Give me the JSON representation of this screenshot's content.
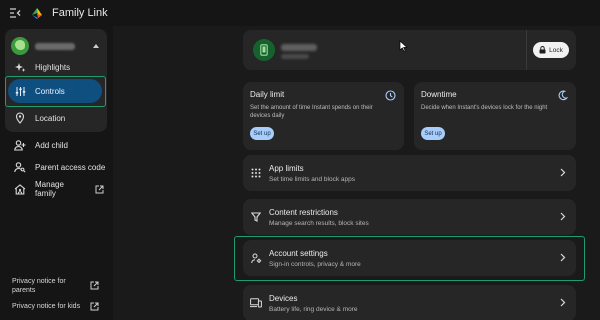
{
  "app": {
    "title": "Family Link"
  },
  "icons": {
    "menu": "menu-collapse-icon",
    "logo": "family-link-logo",
    "highlights": "sparkle-icon",
    "controls": "sliders-icon",
    "location": "location-pin-icon",
    "add_child": "add-person-icon",
    "parent_code": "person-key-icon",
    "manage_family": "family-house-icon",
    "external": "external-link-icon",
    "lock": "lock-icon",
    "daily_limit": "clock-icon",
    "downtime": "moon-icon",
    "app_limits": "apps-grid-icon",
    "content": "filter-icon",
    "account": "account-settings-icon",
    "devices": "devices-icon",
    "chevron": "chevron-right-icon"
  },
  "colors": {
    "accent_blue": "#0f4f7f",
    "button_blue": "#a9cdfa",
    "highlight_outline": "#1f9d6e",
    "avatar_green": "#3b9a3e"
  },
  "sidebar": {
    "nav": [
      {
        "label": "Highlights"
      },
      {
        "label": "Controls",
        "selected": true
      },
      {
        "label": "Location"
      }
    ],
    "actions": [
      {
        "label": "Add child"
      },
      {
        "label": "Parent access code"
      },
      {
        "label": "Manage family"
      }
    ],
    "footer": {
      "privacy_parents": "Privacy notice for parents",
      "privacy_kids": "Privacy notice for kids"
    }
  },
  "device_card": {
    "lock_label": "Lock"
  },
  "tiles": {
    "daily_limit": {
      "title": "Daily limit",
      "description": "Set the amount of time Instant spends on their devices daily",
      "button": "Set up"
    },
    "downtime": {
      "title": "Downtime",
      "description": "Decide when Instant's devices lock for the night",
      "button": "Set up"
    }
  },
  "rows": {
    "app_limits": {
      "title": "App limits",
      "subtitle": "Set time limits and block apps"
    },
    "content_restrictions": {
      "title": "Content restrictions",
      "subtitle": "Manage search results, block sites"
    },
    "account_settings": {
      "title": "Account settings",
      "subtitle": "Sign-in controls, privacy & more"
    },
    "devices": {
      "title": "Devices",
      "subtitle": "Battery life, ring device & more"
    }
  }
}
